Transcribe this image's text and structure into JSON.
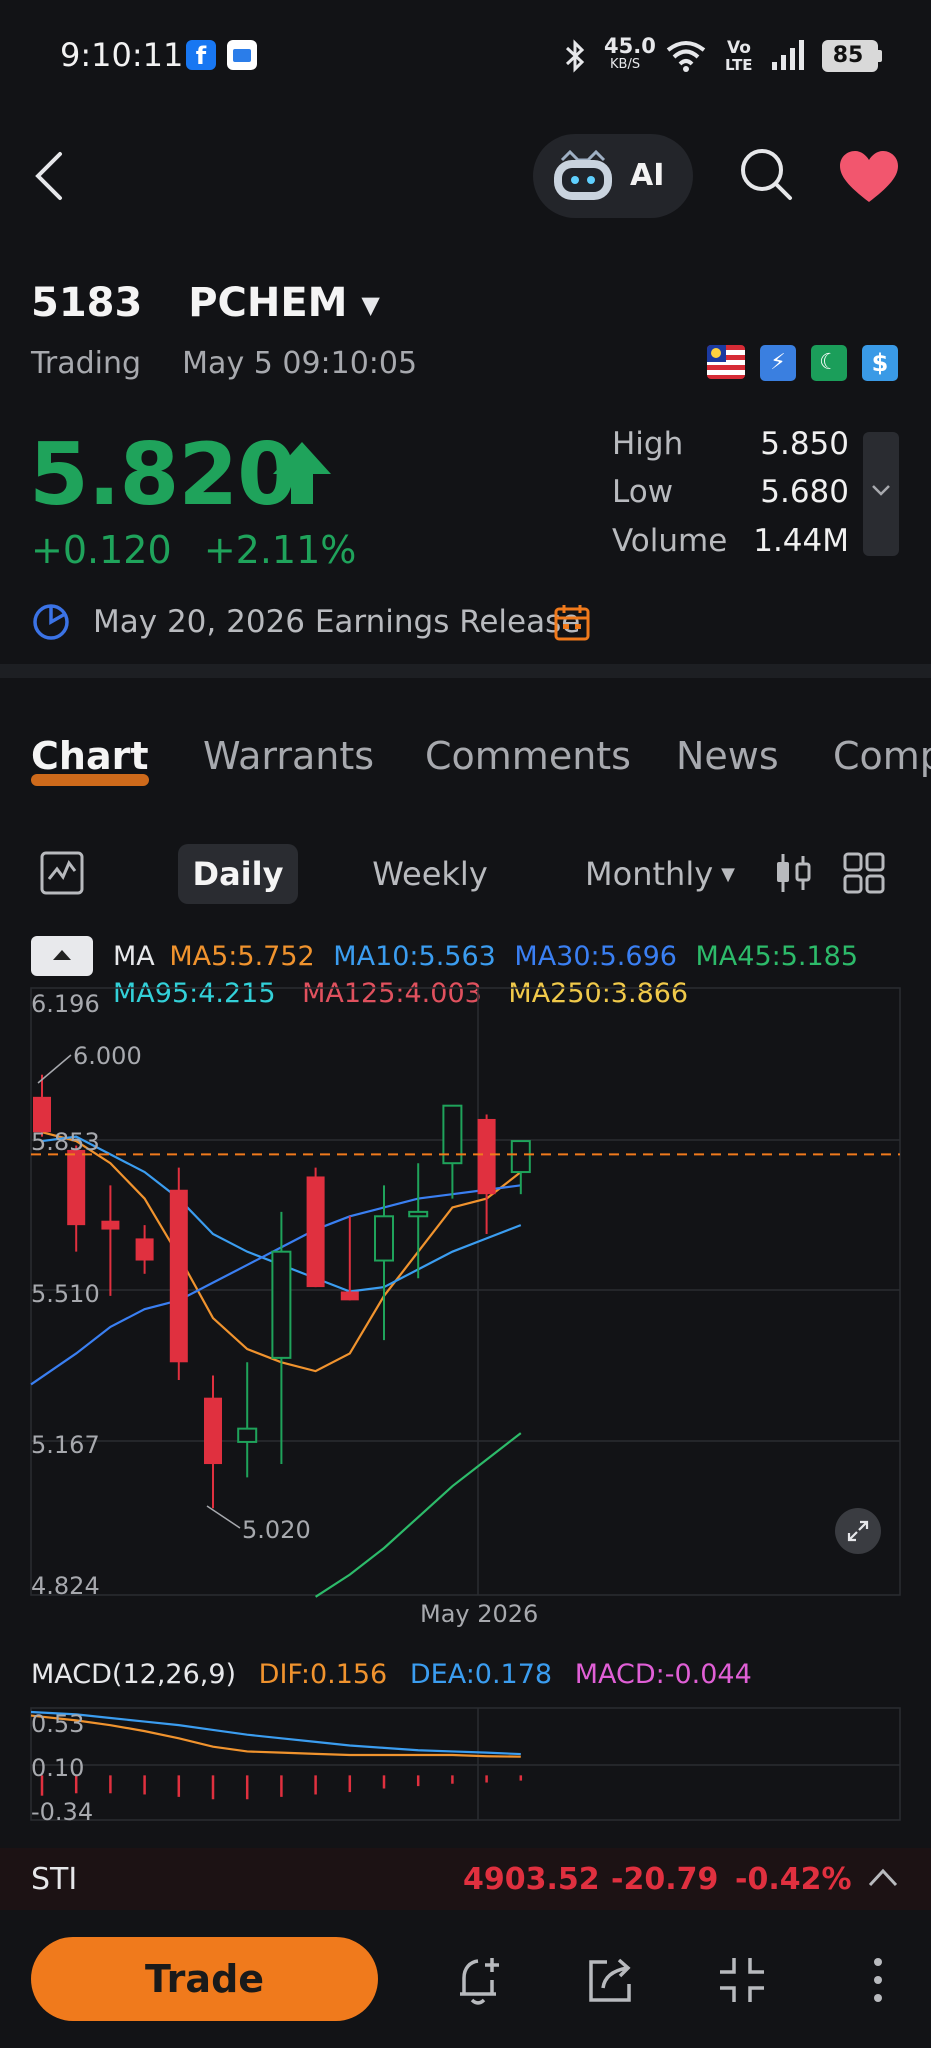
{
  "status_bar": {
    "time": "9:10:11",
    "net_speed_value": "45.0",
    "net_speed_unit": "KB/S",
    "volte_top": "Vo",
    "volte_bottom": "LTE",
    "battery": "85"
  },
  "header": {
    "ai_label": "AI"
  },
  "quote": {
    "code": "5183",
    "name": "PCHEM",
    "status": "Trading",
    "datetime": "May 5 09:10:05",
    "price": "5.820",
    "change": "+0.120",
    "change_pct": "+2.11%",
    "high_label": "High",
    "high": "5.850",
    "low_label": "Low",
    "low": "5.680",
    "volume_label": "Volume",
    "volume": "1.44M",
    "earnings": "May 20, 2026 Earnings Release",
    "colors": {
      "up": "#1fa35b",
      "down": "#e0303f",
      "accent": "#f07a1c"
    }
  },
  "tabs": {
    "chart": "Chart",
    "warrants": "Warrants",
    "comments": "Comments",
    "news": "News",
    "company": "Comp"
  },
  "periods": {
    "daily": "Daily",
    "weekly": "Weekly",
    "monthly": "Monthly"
  },
  "ma_legend": {
    "title": "MA",
    "ma5": "MA5:5.752",
    "ma10": "MA10:5.563",
    "ma30": "MA30:5.696",
    "ma45": "MA45:5.185",
    "ma95": "MA95:4.215",
    "ma125": "MA125:4.003",
    "ma250": "MA250:3.866"
  },
  "macd_legend": {
    "title": "MACD(12,26,9)",
    "dif": "DIF:0.156",
    "dea": "DEA:0.178",
    "macd": "MACD:-0.044"
  },
  "chart_data": {
    "type": "candlestick",
    "y_ticks": [
      "6.196",
      "5.853",
      "5.510",
      "5.167",
      "4.824"
    ],
    "ylim": [
      4.824,
      6.196
    ],
    "x_label": "May 2026",
    "high_annotation": "6.000",
    "low_annotation": "5.020",
    "last_price_line": 5.82,
    "candles": [
      {
        "o": 5.95,
        "h": 6.0,
        "l": 5.86,
        "c": 5.87
      },
      {
        "o": 5.83,
        "h": 5.84,
        "l": 5.6,
        "c": 5.66
      },
      {
        "o": 5.67,
        "h": 5.75,
        "l": 5.5,
        "c": 5.65
      },
      {
        "o": 5.63,
        "h": 5.66,
        "l": 5.55,
        "c": 5.58
      },
      {
        "o": 5.74,
        "h": 5.79,
        "l": 5.31,
        "c": 5.35
      },
      {
        "o": 5.27,
        "h": 5.32,
        "l": 5.02,
        "c": 5.12
      },
      {
        "o": 5.17,
        "h": 5.35,
        "l": 5.09,
        "c": 5.2
      },
      {
        "o": 5.36,
        "h": 5.69,
        "l": 5.12,
        "c": 5.6
      },
      {
        "o": 5.77,
        "h": 5.79,
        "l": 5.52,
        "c": 5.52
      },
      {
        "o": 5.51,
        "h": 5.68,
        "l": 5.49,
        "c": 5.49
      },
      {
        "o": 5.58,
        "h": 5.75,
        "l": 5.4,
        "c": 5.68
      },
      {
        "o": 5.68,
        "h": 5.8,
        "l": 5.54,
        "c": 5.69
      },
      {
        "o": 5.8,
        "h": 5.93,
        "l": 5.72,
        "c": 5.93
      },
      {
        "o": 5.9,
        "h": 5.91,
        "l": 5.64,
        "c": 5.73
      },
      {
        "o": 5.78,
        "h": 5.85,
        "l": 5.73,
        "c": 5.85
      }
    ],
    "ma5": [
      5.87,
      5.85,
      5.8,
      5.72,
      5.59,
      5.45,
      5.38,
      5.35,
      5.33,
      5.37,
      5.5,
      5.6,
      5.7,
      5.72,
      5.78
    ],
    "ma10": [
      5.85,
      5.86,
      5.82,
      5.78,
      5.72,
      5.64,
      5.6,
      5.57,
      5.54,
      5.51,
      5.52,
      5.56,
      5.6,
      5.63,
      5.66
    ],
    "ma30": [
      5.3,
      5.37,
      5.43,
      5.47,
      5.49,
      5.53,
      5.57,
      5.61,
      5.65,
      5.68,
      5.7,
      5.72,
      5.73,
      5.74,
      5.75
    ],
    "ma45": [
      null,
      null,
      null,
      null,
      null,
      null,
      null,
      null,
      4.82,
      4.87,
      4.93,
      5.0,
      5.07,
      5.13,
      5.19
    ],
    "macd": {
      "y_ticks": [
        "0.53",
        "0.10",
        "-0.34"
      ],
      "ylim": [
        -0.34,
        0.53
      ],
      "dif": [
        0.5,
        0.46,
        0.42,
        0.37,
        0.31,
        0.24,
        0.2,
        0.19,
        0.18,
        0.17,
        0.17,
        0.17,
        0.17,
        0.16,
        0.156
      ],
      "dea": [
        0.53,
        0.51,
        0.48,
        0.45,
        0.42,
        0.38,
        0.34,
        0.31,
        0.28,
        0.25,
        0.23,
        0.21,
        0.2,
        0.19,
        0.178
      ],
      "hist": [
        -0.17,
        -0.15,
        -0.15,
        -0.16,
        -0.18,
        -0.2,
        -0.2,
        -0.18,
        -0.16,
        -0.14,
        -0.11,
        -0.09,
        -0.07,
        -0.06,
        -0.044
      ]
    }
  },
  "bottom_ticker": {
    "name": "STI",
    "value": "4903.52",
    "change": "-20.79",
    "change_pct": "-0.42%"
  },
  "bottom_bar": {
    "trade": "Trade"
  }
}
